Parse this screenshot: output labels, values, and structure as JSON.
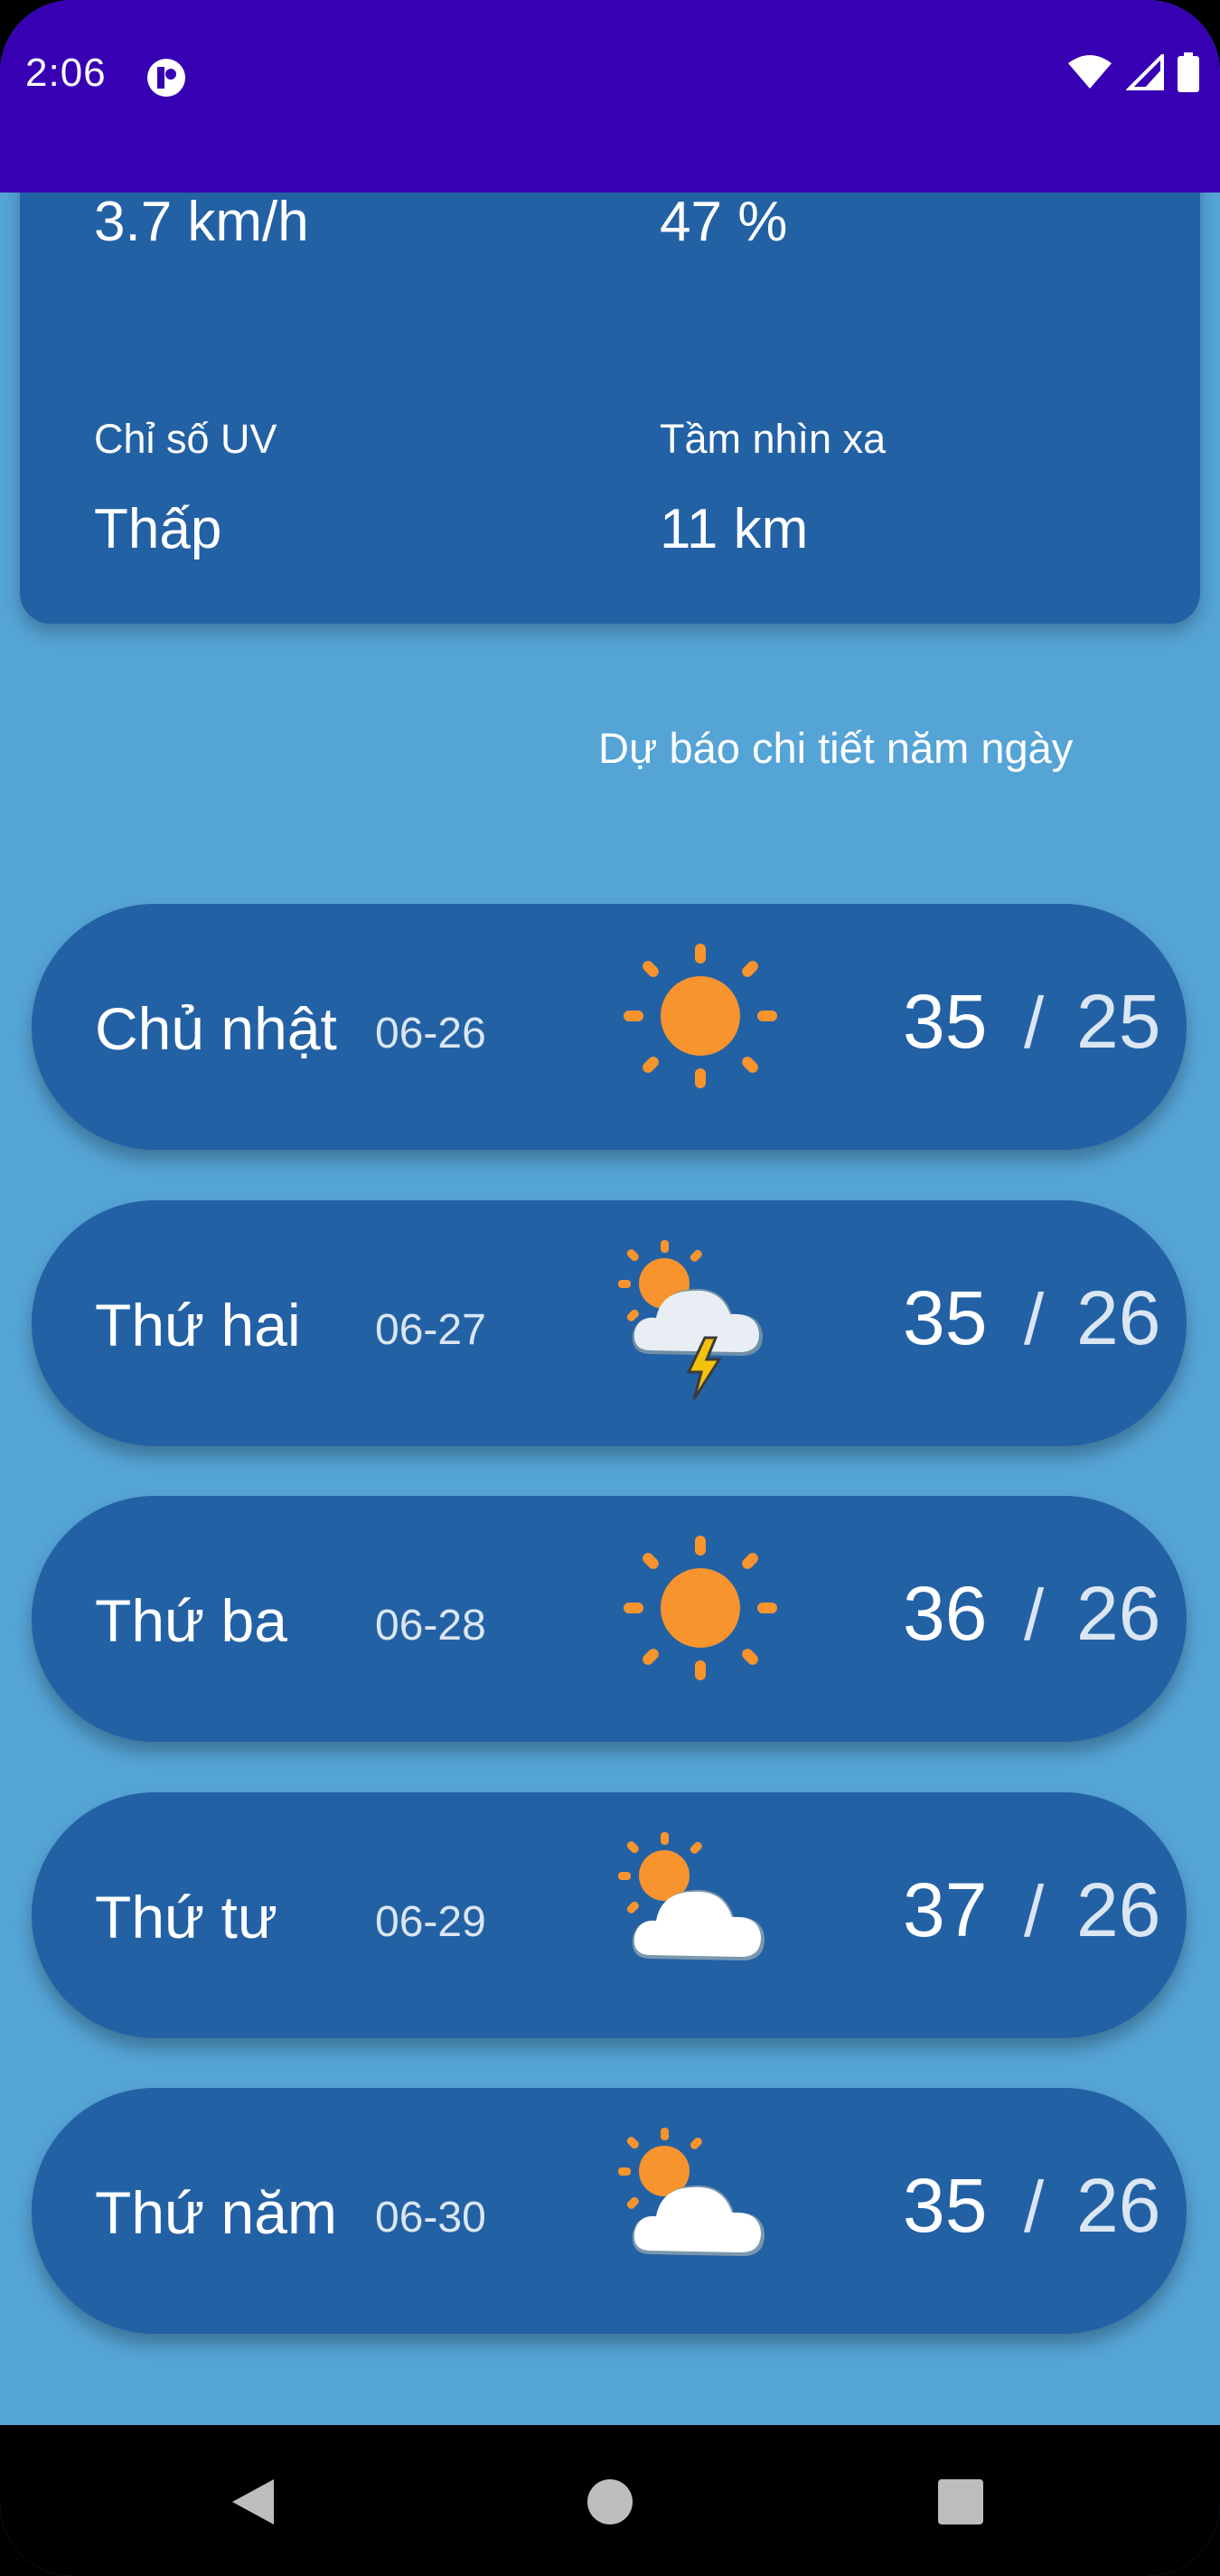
{
  "status_bar": {
    "time": "2:06",
    "icons": [
      "app-notification-icon",
      "wifi-icon",
      "signal-icon",
      "battery-icon"
    ]
  },
  "details": {
    "wind_value": "3.7 km/h",
    "humidity_value": "47 %",
    "uv_label": "Chỉ số UV",
    "uv_value": "Thấp",
    "visibility_label": "Tầm nhìn xa",
    "visibility_value": "11 km"
  },
  "forecast": {
    "heading": "Dự báo chi tiết năm ngày",
    "days": [
      {
        "day": "Chủ nhật",
        "date": "06-26",
        "icon": "sunny-icon",
        "high": "35",
        "sep": "/",
        "low": "25"
      },
      {
        "day": "Thứ hai",
        "date": "06-27",
        "icon": "thunderstorm-icon",
        "high": "35",
        "sep": "/",
        "low": "26"
      },
      {
        "day": "Thứ ba",
        "date": "06-28",
        "icon": "sunny-icon",
        "high": "36",
        "sep": "/",
        "low": "26"
      },
      {
        "day": "Thứ tư",
        "date": "06-29",
        "icon": "partly-cloudy-icon",
        "high": "37",
        "sep": "/",
        "low": "26"
      },
      {
        "day": "Thứ năm",
        "date": "06-30",
        "icon": "partly-cloudy-icon",
        "high": "35",
        "sep": "/",
        "low": "26"
      }
    ]
  },
  "colors": {
    "status_bar": "#3700b3",
    "background": "#55a4d6",
    "card": "#2361a5",
    "sun": "#f7942e",
    "bolt": "#f4c20d"
  },
  "nav_bar": {
    "buttons": [
      "back-icon",
      "home-icon",
      "recents-icon"
    ]
  }
}
